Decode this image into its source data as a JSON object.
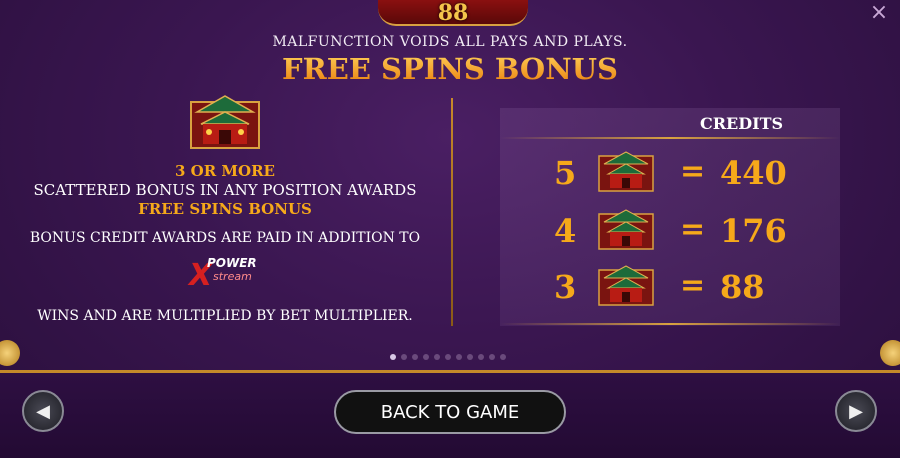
{
  "header": {
    "logo_text": "88",
    "close_icon": "×"
  },
  "notice": "MALFUNCTION VOIDS ALL PAYS AND PLAYS.",
  "title": "FREE SPINS BONUS",
  "left": {
    "symbol": "temple-scatter-symbol",
    "line1": "3 OR MORE",
    "line2": "SCATTERED BONUS IN ANY POSITION AWARDS",
    "line3": "FREE SPINS BONUS",
    "line4": "BONUS CREDIT AWARDS ARE PAID IN ADDITION TO",
    "logo": {
      "x": "X",
      "power": "POWER",
      "stream": "stream"
    },
    "line5": "WINS AND ARE MULTIPLIED BY BET MULTIPLIER."
  },
  "paytable": {
    "header": "CREDITS",
    "rows": [
      {
        "count": "5",
        "equals": "=",
        "value": "440"
      },
      {
        "count": "4",
        "equals": "=",
        "value": "176"
      },
      {
        "count": "3",
        "equals": "=",
        "value": "88"
      }
    ]
  },
  "pager": {
    "total": 11,
    "active": 1
  },
  "footer": {
    "back_label": "BACK TO GAME",
    "prev_icon": "◀",
    "next_icon": "▶"
  },
  "colors": {
    "gold": "#f6a91a",
    "background": "#3a1650",
    "accent_line": "#c48a2a"
  }
}
